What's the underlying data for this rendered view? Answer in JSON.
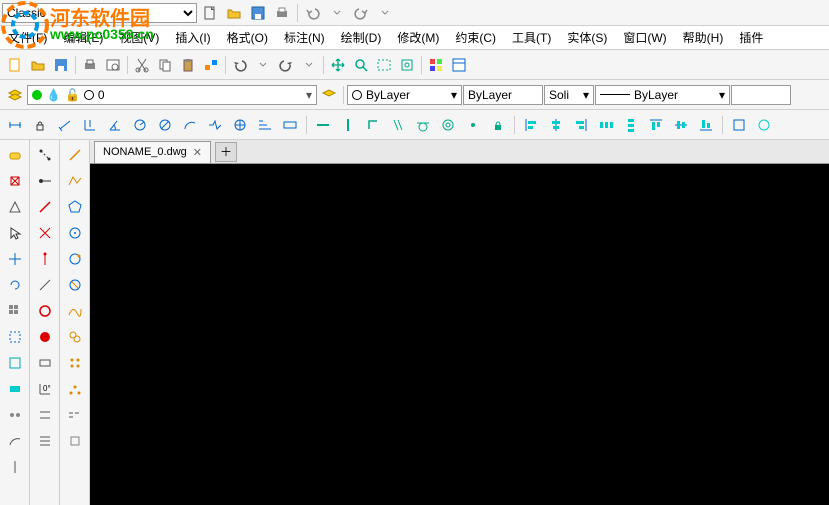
{
  "workspace": {
    "value": "Classic"
  },
  "menu": {
    "file": "文件(F)",
    "edit": "编辑(E)",
    "view": "视图(V)",
    "insert": "插入(I)",
    "format": "格式(O)",
    "annotate": "标注(N)",
    "draw": "绘制(D)",
    "modify": "修改(M)",
    "constraint": "约束(C)",
    "tools": "工具(T)",
    "entity": "实体(S)",
    "window": "窗口(W)",
    "help": "帮助(H)",
    "plugin": "插件"
  },
  "layer": {
    "current": "0"
  },
  "props": {
    "color": "ByLayer",
    "linetype_a": "ByLayer",
    "linetype_b": "Soli",
    "lineweight": "ByLayer"
  },
  "tab": {
    "name": "NONAME_0.dwg"
  },
  "watermark": {
    "title": "河东软件园",
    "url": "www.pc0359.cn"
  }
}
